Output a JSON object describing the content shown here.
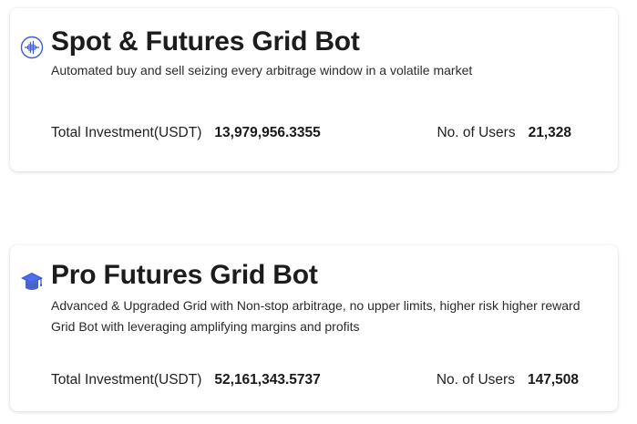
{
  "bots": [
    {
      "icon": "waveform-icon",
      "title": "Spot & Futures Grid Bot",
      "description": "Automated buy and sell seizing every arbitrage window in a volatile market",
      "investment_label": "Total Investment(USDT)",
      "investment_value": "13,979,956.3355",
      "users_label": "No. of Users",
      "users_value": "21,328"
    },
    {
      "icon": "graduation-cap-icon",
      "title": "Pro Futures Grid Bot",
      "description": "Advanced & Upgraded Grid with Non-stop arbitrage, no upper limits, higher risk higher reward Grid Bot with leveraging amplifying margins and profits",
      "investment_label": "Total Investment(USDT)",
      "investment_value": "52,161,343.5737",
      "users_label": "No. of Users",
      "users_value": "147,508"
    }
  ],
  "colors": {
    "icon_blue": "#3b5bdb",
    "text": "#1c1c1c",
    "card_background": "#ffffff"
  }
}
